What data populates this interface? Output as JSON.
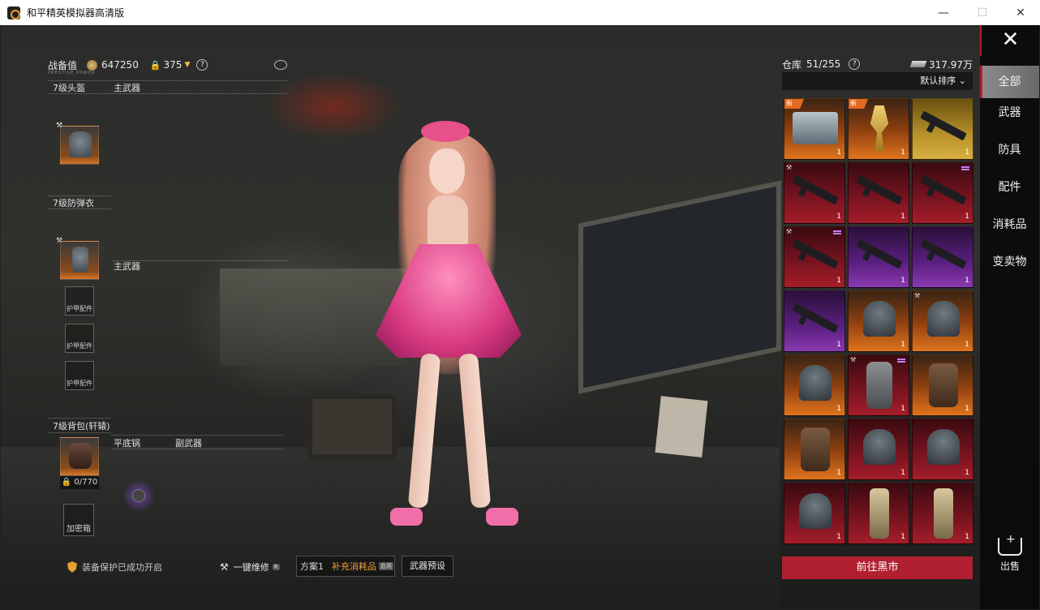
{
  "window": {
    "title": "和平精英模拟器高清版",
    "controls": {
      "minimize": "—",
      "maximize": "☐",
      "close": "✕"
    }
  },
  "left_panel": {
    "combat_label": "战备值",
    "combat_value": "647250",
    "lock_value": "375",
    "help": "?",
    "sub_caption": "PRESTIGE POWER",
    "helmet_label": "7级头盔",
    "primary_weapon_label": "主武器",
    "armor_label": "7级防弹衣",
    "primary_weapon_label_2": "主武器",
    "armor_attachments": [
      "护甲配件",
      "护甲配件",
      "护甲配件"
    ],
    "backpack_label": "7级背包(轩辕)",
    "backpack_capacity": "0/770",
    "pan_label": "平底锅",
    "secondary_weapon_label": "副武器",
    "encrypted_box_label": "加密箱"
  },
  "bottom_bar": {
    "protection_text": "装备保护已成功开启",
    "repair_text": "一键维修",
    "repair_tag": "R",
    "plan_label": "方案1",
    "supply_text": "补充消耗品",
    "supply_tag": "启用",
    "preset_text": "武器预设"
  },
  "right_panel": {
    "warehouse_label": "仓库",
    "warehouse_count": "51/255",
    "help": "?",
    "money": "317.97万",
    "sort_label": "默认排序",
    "market_button": "前往黑市",
    "new_tag": "新",
    "items": [
      {
        "kind": "box",
        "rarity": "orange",
        "count": "1",
        "new": true
      },
      {
        "kind": "trophy",
        "rarity": "orange",
        "count": "1",
        "new": true
      },
      {
        "kind": "gun",
        "rarity": "gold",
        "count": "1"
      },
      {
        "kind": "gun",
        "rarity": "red",
        "count": "1",
        "tool": true
      },
      {
        "kind": "gun",
        "rarity": "red",
        "count": "1"
      },
      {
        "kind": "gun",
        "rarity": "red",
        "count": "1",
        "level": true
      },
      {
        "kind": "gun",
        "rarity": "red",
        "count": "1",
        "tool": true,
        "level": true
      },
      {
        "kind": "gun",
        "rarity": "purple",
        "count": "1"
      },
      {
        "kind": "gun",
        "rarity": "purple",
        "count": "1"
      },
      {
        "kind": "gun",
        "rarity": "purple",
        "count": "1"
      },
      {
        "kind": "helmet",
        "rarity": "orange",
        "count": "1"
      },
      {
        "kind": "helmet",
        "rarity": "orange",
        "count": "1",
        "tool": true
      },
      {
        "kind": "helmet",
        "rarity": "orange",
        "count": "1"
      },
      {
        "kind": "vest",
        "rarity": "red",
        "count": "1",
        "tool": true,
        "level": true
      },
      {
        "kind": "pack",
        "rarity": "orange",
        "count": "1"
      },
      {
        "kind": "pack",
        "rarity": "orange",
        "count": "1"
      },
      {
        "kind": "helmet",
        "rarity": "red",
        "count": "1"
      },
      {
        "kind": "helmet",
        "rarity": "red",
        "count": "1"
      },
      {
        "kind": "helmet",
        "rarity": "red",
        "count": "1"
      },
      {
        "kind": "suit",
        "rarity": "red",
        "count": "1"
      },
      {
        "kind": "suit",
        "rarity": "red",
        "count": "1"
      }
    ]
  },
  "side_tabs": {
    "close": "✕",
    "tabs": [
      "全部",
      "武器",
      "防具",
      "配件",
      "消耗品",
      "变卖物"
    ],
    "active": "全部",
    "sell_label": "出售"
  },
  "colors": {
    "accent_red": "#b02030",
    "rarity_orange": "#e0741e",
    "rarity_red": "#a41e2a",
    "rarity_purple": "#8a3ab0",
    "rarity_gold": "#d8b040"
  }
}
